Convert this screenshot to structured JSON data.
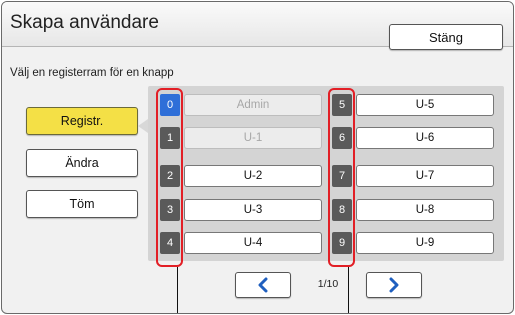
{
  "window": {
    "title": "Skapa användare",
    "close_label": "Stäng"
  },
  "instruction": "Välj en registerram för en knapp",
  "side_buttons": [
    {
      "label": "Registr.",
      "active": true
    },
    {
      "label": "Ändra",
      "active": false
    },
    {
      "label": "Töm",
      "active": false
    }
  ],
  "slots": [
    {
      "number": "0",
      "label": "Admin",
      "disabled": true,
      "selected": true
    },
    {
      "number": "1",
      "label": "U-1",
      "disabled": true,
      "selected": false
    },
    {
      "number": "2",
      "label": "U-2",
      "disabled": false,
      "selected": false
    },
    {
      "number": "3",
      "label": "U-3",
      "disabled": false,
      "selected": false
    },
    {
      "number": "4",
      "label": "U-4",
      "disabled": false,
      "selected": false
    },
    {
      "number": "5",
      "label": "U-5",
      "disabled": false,
      "selected": false
    },
    {
      "number": "6",
      "label": "U-6",
      "disabled": false,
      "selected": false
    },
    {
      "number": "7",
      "label": "U-7",
      "disabled": false,
      "selected": false
    },
    {
      "number": "8",
      "label": "U-8",
      "disabled": false,
      "selected": false
    },
    {
      "number": "9",
      "label": "U-9",
      "disabled": false,
      "selected": false
    }
  ],
  "pagination": {
    "indicator": "1/10",
    "prev_icon": "chevron-left-icon",
    "next_icon": "chevron-right-icon"
  },
  "colors": {
    "active_button": "#f4e046",
    "selected_number": "#2f6fd8",
    "number_badge": "#5a5a5a",
    "highlight": "#e21f26",
    "arrow": "#1f5fbf"
  }
}
